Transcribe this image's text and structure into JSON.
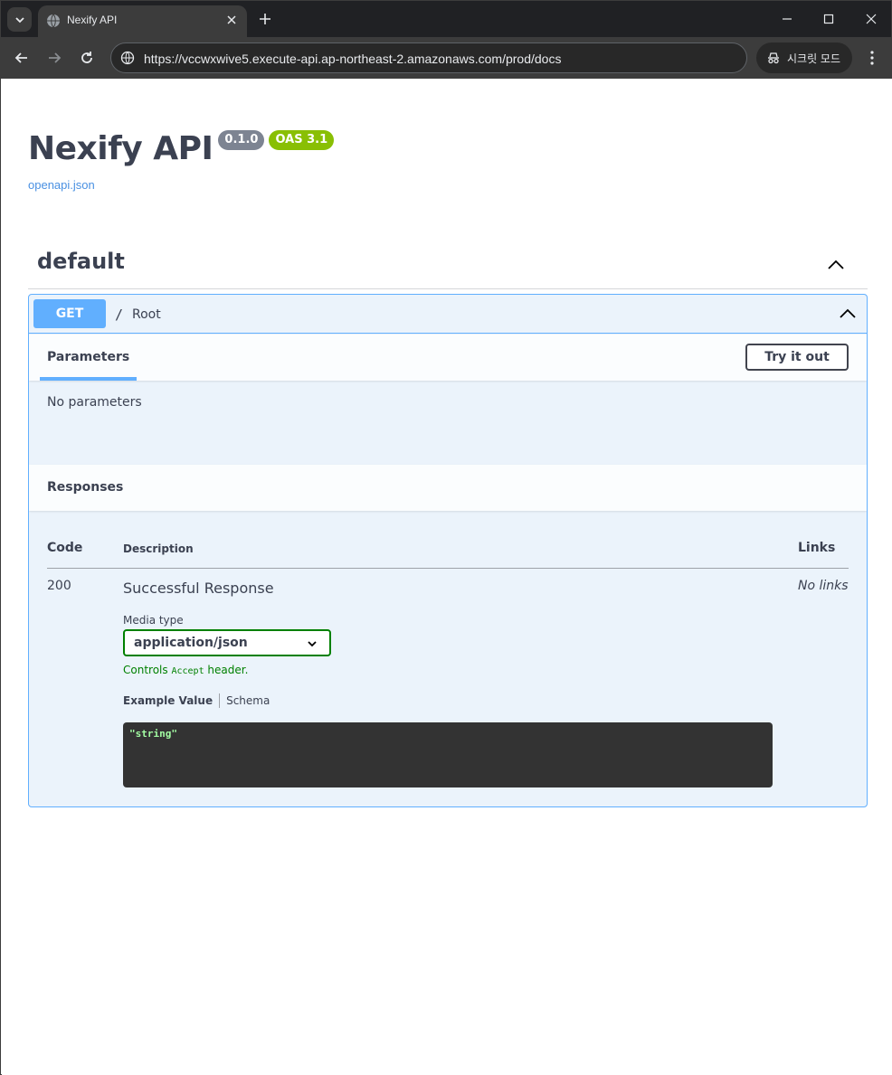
{
  "browser": {
    "tab_title": "Nexify API",
    "url": "https://vccwxwive5.execute-api.ap-northeast-2.amazonaws.com/prod/docs",
    "incognito_label": "시크릿 모드",
    "icons": {
      "tab_list": "chevron-down-icon",
      "favicon": "globe-icon",
      "tab_close": "close-icon",
      "new_tab": "plus-icon",
      "minimize": "minimize-icon",
      "maximize": "maximize-icon",
      "close_window": "close-icon",
      "back": "back-arrow-icon",
      "forward": "forward-arrow-icon",
      "reload": "reload-icon",
      "site_info": "site-info-icon",
      "incognito": "incognito-icon",
      "menu": "kebab-menu-icon"
    }
  },
  "page": {
    "title": "Nexify API",
    "version_badge": "0.1.0",
    "oas_badge": "OAS 3.1",
    "openapi_link": "openapi.json",
    "tag": {
      "name": "default"
    },
    "operation": {
      "method": "GET",
      "path": "/",
      "summary": "Root",
      "parameters_tab": "Parameters",
      "try_button": "Try it out",
      "no_params": "No parameters",
      "responses_title": "Responses",
      "columns": {
        "code": "Code",
        "description": "Description",
        "links": "Links"
      },
      "response": {
        "code": "200",
        "description": "Successful Response",
        "links": "No links",
        "media_type_label": "Media type",
        "media_type_value": "application/json",
        "controls_prefix": "Controls",
        "controls_code": "Accept",
        "controls_suffix": "header.",
        "example_tab": "Example Value",
        "schema_tab": "Schema",
        "example_code": "\"string\""
      }
    }
  },
  "colors": {
    "get_method": "#61affe",
    "opblock_bg": "#ebf3fb",
    "version_badge": "#7d8492",
    "oas_badge": "#89bf04",
    "media_select_border": "#008000",
    "code_bg": "#333333",
    "code_text": "#a2fca2"
  }
}
